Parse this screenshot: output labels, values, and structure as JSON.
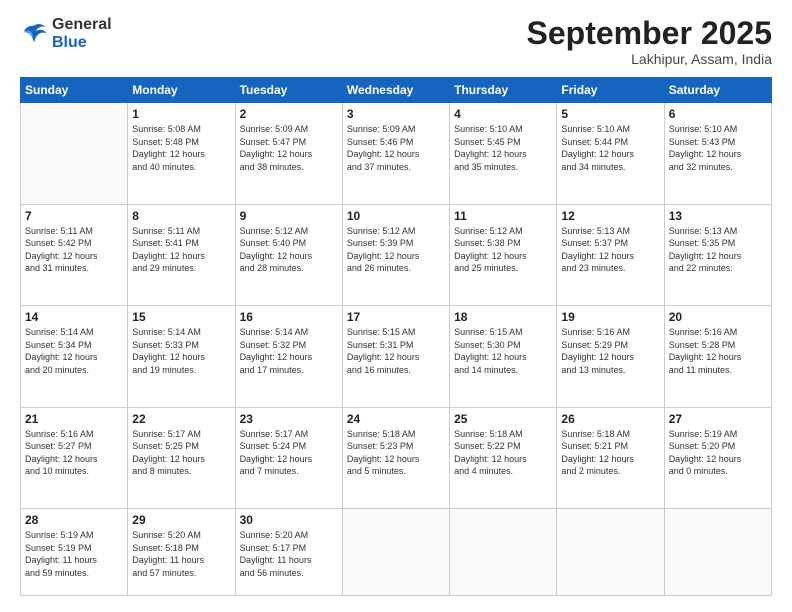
{
  "logo": {
    "line1": "General",
    "line2": "Blue"
  },
  "title": "September 2025",
  "location": "Lakhipur, Assam, India",
  "days_header": [
    "Sunday",
    "Monday",
    "Tuesday",
    "Wednesday",
    "Thursday",
    "Friday",
    "Saturday"
  ],
  "weeks": [
    [
      {
        "day": "",
        "info": ""
      },
      {
        "day": "1",
        "info": "Sunrise: 5:08 AM\nSunset: 5:48 PM\nDaylight: 12 hours\nand 40 minutes."
      },
      {
        "day": "2",
        "info": "Sunrise: 5:09 AM\nSunset: 5:47 PM\nDaylight: 12 hours\nand 38 minutes."
      },
      {
        "day": "3",
        "info": "Sunrise: 5:09 AM\nSunset: 5:46 PM\nDaylight: 12 hours\nand 37 minutes."
      },
      {
        "day": "4",
        "info": "Sunrise: 5:10 AM\nSunset: 5:45 PM\nDaylight: 12 hours\nand 35 minutes."
      },
      {
        "day": "5",
        "info": "Sunrise: 5:10 AM\nSunset: 5:44 PM\nDaylight: 12 hours\nand 34 minutes."
      },
      {
        "day": "6",
        "info": "Sunrise: 5:10 AM\nSunset: 5:43 PM\nDaylight: 12 hours\nand 32 minutes."
      }
    ],
    [
      {
        "day": "7",
        "info": "Sunrise: 5:11 AM\nSunset: 5:42 PM\nDaylight: 12 hours\nand 31 minutes."
      },
      {
        "day": "8",
        "info": "Sunrise: 5:11 AM\nSunset: 5:41 PM\nDaylight: 12 hours\nand 29 minutes."
      },
      {
        "day": "9",
        "info": "Sunrise: 5:12 AM\nSunset: 5:40 PM\nDaylight: 12 hours\nand 28 minutes."
      },
      {
        "day": "10",
        "info": "Sunrise: 5:12 AM\nSunset: 5:39 PM\nDaylight: 12 hours\nand 26 minutes."
      },
      {
        "day": "11",
        "info": "Sunrise: 5:12 AM\nSunset: 5:38 PM\nDaylight: 12 hours\nand 25 minutes."
      },
      {
        "day": "12",
        "info": "Sunrise: 5:13 AM\nSunset: 5:37 PM\nDaylight: 12 hours\nand 23 minutes."
      },
      {
        "day": "13",
        "info": "Sunrise: 5:13 AM\nSunset: 5:35 PM\nDaylight: 12 hours\nand 22 minutes."
      }
    ],
    [
      {
        "day": "14",
        "info": "Sunrise: 5:14 AM\nSunset: 5:34 PM\nDaylight: 12 hours\nand 20 minutes."
      },
      {
        "day": "15",
        "info": "Sunrise: 5:14 AM\nSunset: 5:33 PM\nDaylight: 12 hours\nand 19 minutes."
      },
      {
        "day": "16",
        "info": "Sunrise: 5:14 AM\nSunset: 5:32 PM\nDaylight: 12 hours\nand 17 minutes."
      },
      {
        "day": "17",
        "info": "Sunrise: 5:15 AM\nSunset: 5:31 PM\nDaylight: 12 hours\nand 16 minutes."
      },
      {
        "day": "18",
        "info": "Sunrise: 5:15 AM\nSunset: 5:30 PM\nDaylight: 12 hours\nand 14 minutes."
      },
      {
        "day": "19",
        "info": "Sunrise: 5:16 AM\nSunset: 5:29 PM\nDaylight: 12 hours\nand 13 minutes."
      },
      {
        "day": "20",
        "info": "Sunrise: 5:16 AM\nSunset: 5:28 PM\nDaylight: 12 hours\nand 11 minutes."
      }
    ],
    [
      {
        "day": "21",
        "info": "Sunrise: 5:16 AM\nSunset: 5:27 PM\nDaylight: 12 hours\nand 10 minutes."
      },
      {
        "day": "22",
        "info": "Sunrise: 5:17 AM\nSunset: 5:25 PM\nDaylight: 12 hours\nand 8 minutes."
      },
      {
        "day": "23",
        "info": "Sunrise: 5:17 AM\nSunset: 5:24 PM\nDaylight: 12 hours\nand 7 minutes."
      },
      {
        "day": "24",
        "info": "Sunrise: 5:18 AM\nSunset: 5:23 PM\nDaylight: 12 hours\nand 5 minutes."
      },
      {
        "day": "25",
        "info": "Sunrise: 5:18 AM\nSunset: 5:22 PM\nDaylight: 12 hours\nand 4 minutes."
      },
      {
        "day": "26",
        "info": "Sunrise: 5:18 AM\nSunset: 5:21 PM\nDaylight: 12 hours\nand 2 minutes."
      },
      {
        "day": "27",
        "info": "Sunrise: 5:19 AM\nSunset: 5:20 PM\nDaylight: 12 hours\nand 0 minutes."
      }
    ],
    [
      {
        "day": "28",
        "info": "Sunrise: 5:19 AM\nSunset: 5:19 PM\nDaylight: 11 hours\nand 59 minutes."
      },
      {
        "day": "29",
        "info": "Sunrise: 5:20 AM\nSunset: 5:18 PM\nDaylight: 11 hours\nand 57 minutes."
      },
      {
        "day": "30",
        "info": "Sunrise: 5:20 AM\nSunset: 5:17 PM\nDaylight: 11 hours\nand 56 minutes."
      },
      {
        "day": "",
        "info": ""
      },
      {
        "day": "",
        "info": ""
      },
      {
        "day": "",
        "info": ""
      },
      {
        "day": "",
        "info": ""
      }
    ]
  ]
}
